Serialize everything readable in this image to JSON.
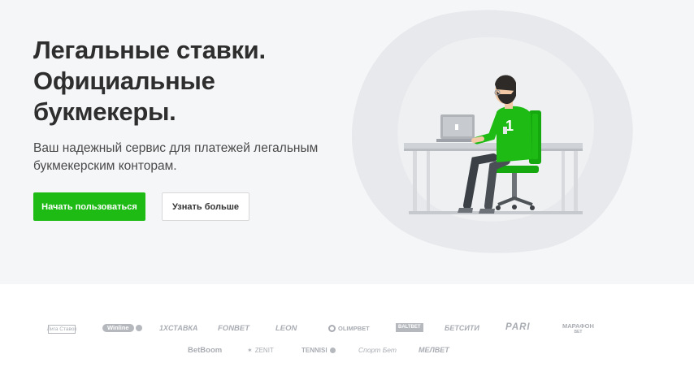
{
  "hero": {
    "title_lines": [
      "Легальные ставки.",
      "Официальные",
      "букмекеры."
    ],
    "subtitle": "Ваш надежный сервис для платежей легальным букмекерским конторам.",
    "primary_button": "Начать пользоваться",
    "secondary_button": "Узнать больше",
    "laptop_badge": "1",
    "shirt_number": "1"
  },
  "colors": {
    "accent": "#1dbb14",
    "hero_bg": "#f5f6f8",
    "blob": "#e8e9ec",
    "logo_gray": "#a9adb3"
  },
  "partners": {
    "row1": [
      {
        "id": "liga-stavok",
        "label": "Лига Ставок"
      },
      {
        "id": "winline",
        "label": "Winline"
      },
      {
        "id": "1xstavka",
        "label": "1XСТАВКА"
      },
      {
        "id": "fonbet",
        "label": "FONBET"
      },
      {
        "id": "leon",
        "label": "LEON"
      },
      {
        "id": "olimpbet",
        "label": "OLIMPBET"
      },
      {
        "id": "baltbet",
        "label": "BALTBET"
      },
      {
        "id": "betcity",
        "label": "БЕТСИТИ"
      },
      {
        "id": "pari",
        "label": "PARI"
      },
      {
        "id": "marathon",
        "label": "МАРАФОН",
        "sub": "BET"
      }
    ],
    "row2": [
      {
        "id": "betboom",
        "label": "BetBoom"
      },
      {
        "id": "zenit",
        "label": "ZENIT"
      },
      {
        "id": "tennisi",
        "label": "TENNISI"
      },
      {
        "id": "sportbet",
        "label": "Спорт Бет"
      },
      {
        "id": "melbet",
        "label": "МЕЛBET"
      }
    ]
  }
}
